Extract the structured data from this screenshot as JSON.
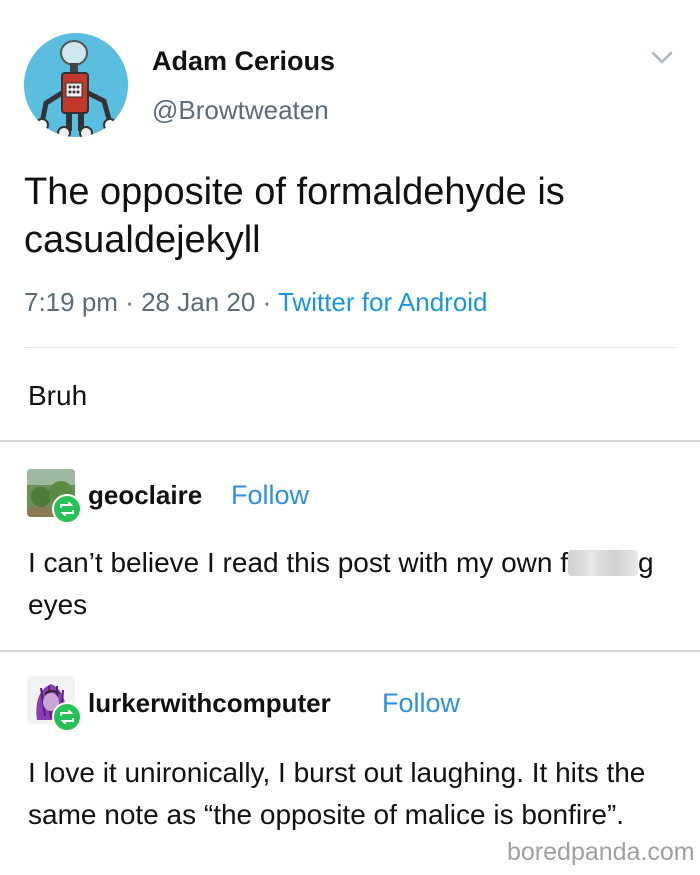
{
  "tweet": {
    "author_name": "Adam Cerious",
    "author_handle": "@Browtweaten",
    "text": "The opposite of formaldehyde is casualdejekyll",
    "time": "7:19 pm",
    "separator1": "·",
    "date": "28 Jan 20",
    "separator2": "·",
    "source": "Twitter for Android",
    "avatar_icon": "robot-avatar",
    "menu_icon": "chevron-down-icon"
  },
  "op_comment": "Bruh",
  "reblogs": [
    {
      "username": "geoclaire",
      "follow_label": "Follow",
      "text_part1": "I can’t believe I read this post with my own f",
      "text_part2": "g eyes"
    },
    {
      "username": "lurkerwithcomputer",
      "follow_label": "Follow",
      "text": "I love it unironically, I burst out laughing. It hits the same note as “the opposite of malice is bonfire”."
    }
  ],
  "watermark": "boredpanda.com",
  "colors": {
    "link_blue": "#1b95e0",
    "follow_blue": "#2f8fe6",
    "reblog_green": "#27c255",
    "muted_gray": "#5b6b78",
    "avatar_bg": "#5bbde0"
  }
}
